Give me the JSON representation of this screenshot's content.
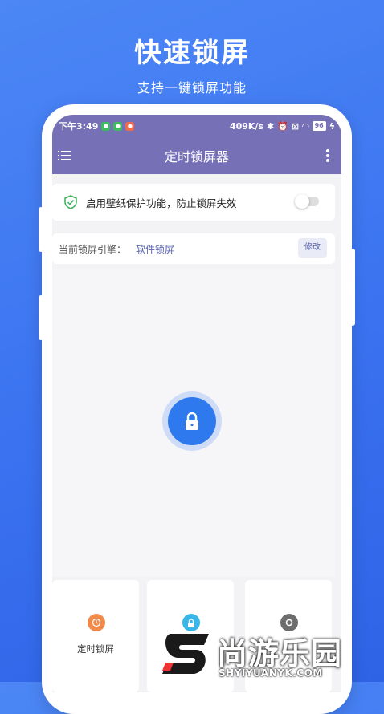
{
  "promo": {
    "title": "快速锁屏",
    "subtitle": "支持一键锁屏功能"
  },
  "statusbar": {
    "time": "下午3:49",
    "speed": "409K/s",
    "battery": "96"
  },
  "appbar": {
    "title": "定时锁屏器",
    "menu_icon": "menu-icon",
    "more_icon": "more-vertical-icon"
  },
  "wallpaper_card": {
    "label": "启用壁纸保护功能，防止锁屏失效",
    "toggle_on": false
  },
  "engine_card": {
    "label": "当前锁屏引擎：",
    "value": "软件锁屏",
    "button": "修改"
  },
  "lock_button": {
    "icon": "lock-icon",
    "color": "#2f79ef"
  },
  "tiles": [
    {
      "label": "定时锁屏",
      "icon": "timer-icon",
      "color": "#f08a4b"
    },
    {
      "label": "",
      "icon": "lock-icon",
      "color": "#38b6e8"
    },
    {
      "label": "",
      "icon": "settings-icon",
      "color": "#6d6d6d"
    }
  ],
  "watermark": {
    "cn": "尚游乐园",
    "en": "SHYIYUANYK.COM"
  },
  "colors": {
    "primary": "#7670b7",
    "background": "#3a72f0"
  }
}
